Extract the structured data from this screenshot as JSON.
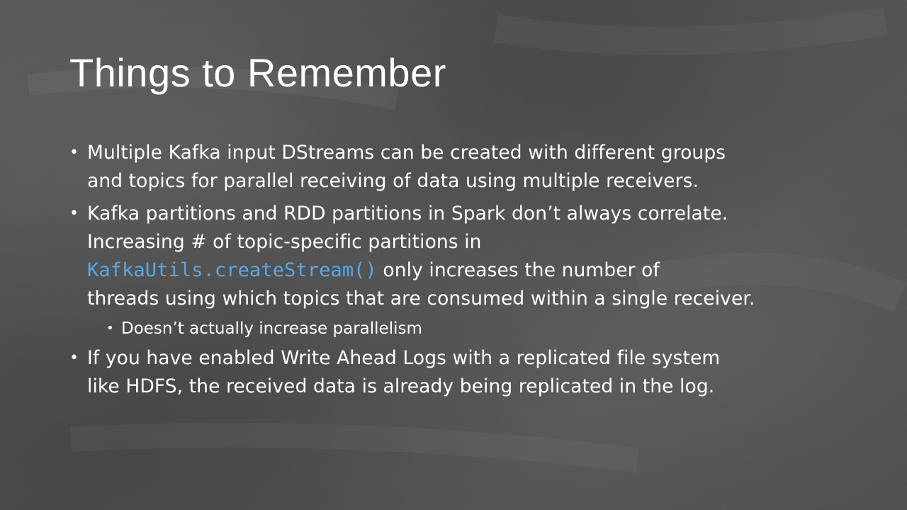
{
  "slide": {
    "title": "Things to Remember",
    "code_color": "#5aa7e6",
    "bullets": [
      {
        "lines": [
          "Multiple Kafka input DStreams can be created with different groups",
          "and topics for parallel receiving of data using multiple receivers."
        ]
      },
      {
        "line1": "Kafka partitions and RDD partitions in Spark don’t always correlate.",
        "line2": "Increasing # of topic-specific partitions in",
        "code": "KafkaUtils.createStream()",
        "line3_after_code": " only increases the number of",
        "line4": "threads using which topics that are consumed within a single receiver.",
        "sub_bullets": [
          "Doesn’t actually increase parallelism"
        ]
      },
      {
        "lines": [
          "If you have enabled Write Ahead Logs with a replicated file system",
          "like HDFS, the received data is already being replicated in the log."
        ]
      }
    ]
  }
}
